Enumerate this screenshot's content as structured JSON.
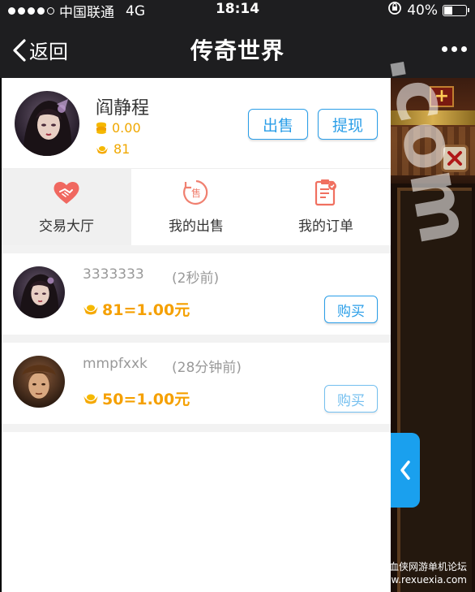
{
  "status_bar": {
    "carrier": "中国联通",
    "network": "4G",
    "time": "18:14",
    "battery": "40%",
    "battery_level": 0.4
  },
  "nav": {
    "back_label": "返回",
    "title": "传奇世界"
  },
  "profile": {
    "name": "阎静程",
    "coins": "0.00",
    "ingots": "81",
    "sell_button": "出售",
    "withdraw_button": "提现"
  },
  "tabs": [
    {
      "label": "交易大厅",
      "icon": "handshake-heart-icon",
      "active": true
    },
    {
      "label": "我的出售",
      "icon": "sell-tag-icon",
      "active": false
    },
    {
      "label": "我的订单",
      "icon": "order-clipboard-icon",
      "active": false
    }
  ],
  "listings": [
    {
      "seller": "3333333",
      "ago": "(2秒前)",
      "price": "81=1.00元",
      "buy_label": "购买"
    },
    {
      "seller": "mmpfxxk",
      "ago": "(28分钟前)",
      "price": "50=1.00元",
      "buy_label": "购买"
    }
  ],
  "watermark": {
    "line1": "热血侠网游单机论坛",
    "line2": "www.rexuexia.com",
    "overlay": ".com"
  },
  "colors": {
    "accent": "#2a9ee8",
    "gold": "#f5a000",
    "nav_bg": "#1e1e20",
    "side_tab": "#1aa0ee"
  }
}
